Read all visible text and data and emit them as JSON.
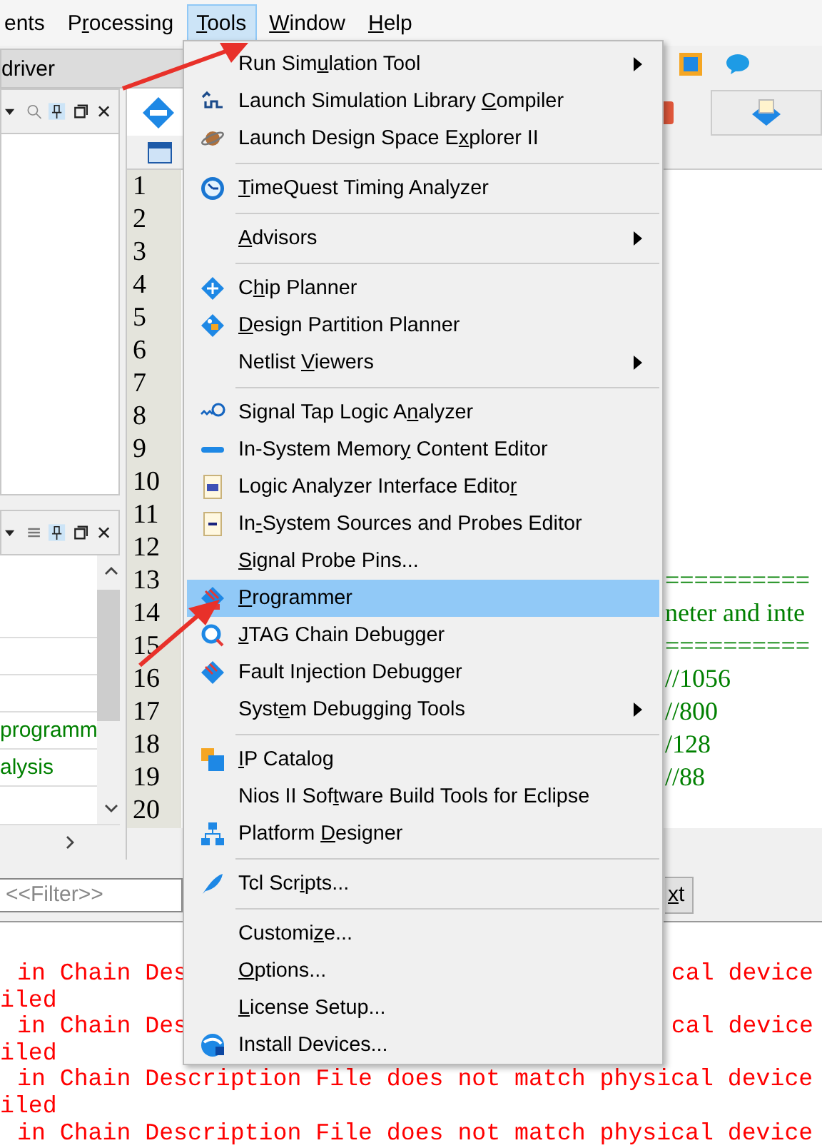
{
  "menu_bar": {
    "items": [
      {
        "label": [
          {
            "text": "ents"
          }
        ],
        "selected": false
      },
      {
        "label": [
          {
            "text": "P"
          },
          {
            "underlined": "r"
          },
          {
            "text": "ocessing"
          }
        ],
        "selected": false
      },
      {
        "label": [
          {
            "underlined": "T"
          },
          {
            "text": "ools"
          }
        ],
        "selected": true
      },
      {
        "label": [
          {
            "underlined": "W"
          },
          {
            "text": "indow"
          }
        ],
        "selected": false
      },
      {
        "label": [
          {
            "underlined": "H"
          },
          {
            "text": "elp"
          }
        ],
        "selected": false
      }
    ]
  },
  "left_panel": {
    "tab": "driver",
    "rows": [
      {
        "text": "programm",
        "color": "#008000"
      },
      {
        "text": "alysis",
        "color": "#008000"
      }
    ]
  },
  "editor": {
    "lines": [
      {
        "number": "1"
      },
      {
        "number": "2"
      },
      {
        "number": "3"
      },
      {
        "number": "4"
      },
      {
        "number": "5"
      },
      {
        "number": "6"
      },
      {
        "number": "7"
      },
      {
        "number": "8"
      },
      {
        "number": "9"
      },
      {
        "number": "10"
      },
      {
        "number": "11"
      },
      {
        "number": "12"
      },
      {
        "number": "13",
        "code": "=========="
      },
      {
        "number": "14",
        "code": "neter and inte"
      },
      {
        "number": "15",
        "code": "=========="
      },
      {
        "number": "16",
        "code": "//1056"
      },
      {
        "number": "17",
        "code": "//800"
      },
      {
        "number": "18",
        "code": "/128"
      },
      {
        "number": "19",
        "code": "//88"
      },
      {
        "number": "20"
      }
    ]
  },
  "filter": {
    "placeholder": "<<Filter>>",
    "button": [
      {
        "underlined": "x"
      },
      {
        "text": "t"
      }
    ]
  },
  "messages": [
    {
      "left": "in Chain Des",
      "right": "cal device"
    },
    {
      "left": "iled"
    },
    {
      "left": "in Chain Des",
      "right": "cal device"
    },
    {
      "left": "iled"
    },
    {
      "left": "in Chain Description File does not match physical device"
    },
    {
      "left": "iled"
    },
    {
      "left": "in Chain Description File does not match physical device"
    }
  ],
  "tools_menu": {
    "items": [
      {
        "kind": "item",
        "label": [
          {
            "text": "Run Sim"
          },
          {
            "underlined": "u"
          },
          {
            "text": "lation Tool"
          }
        ],
        "submenu": true,
        "selected": false
      },
      {
        "kind": "item",
        "label": [
          {
            "text": "Launch Simulation Library "
          },
          {
            "underlined": "C"
          },
          {
            "text": "ompiler"
          }
        ],
        "submenu": false,
        "selected": false
      },
      {
        "kind": "item",
        "label": [
          {
            "text": "Launch Design Space E"
          },
          {
            "underlined": "x"
          },
          {
            "text": "plorer II"
          }
        ],
        "submenu": false,
        "selected": false
      },
      {
        "kind": "separator"
      },
      {
        "kind": "item",
        "label": [
          {
            "underlined": "T"
          },
          {
            "text": "imeQuest Timing Analyzer"
          }
        ],
        "submenu": false,
        "selected": false
      },
      {
        "kind": "separator"
      },
      {
        "kind": "item",
        "label": [
          {
            "underlined": "A"
          },
          {
            "text": "dvisors"
          }
        ],
        "submenu": true,
        "selected": false
      },
      {
        "kind": "separator"
      },
      {
        "kind": "item",
        "label": [
          {
            "text": "C"
          },
          {
            "underlined": "h"
          },
          {
            "text": "ip Planner"
          }
        ],
        "submenu": false,
        "selected": false
      },
      {
        "kind": "item",
        "label": [
          {
            "underlined": "D"
          },
          {
            "text": "esign Partition Planner"
          }
        ],
        "submenu": false,
        "selected": false
      },
      {
        "kind": "item",
        "label": [
          {
            "text": "Netlist "
          },
          {
            "underlined": "V"
          },
          {
            "text": "iewers"
          }
        ],
        "submenu": true,
        "selected": false
      },
      {
        "kind": "separator"
      },
      {
        "kind": "item",
        "label": [
          {
            "text": "Signal Tap Logic A"
          },
          {
            "underlined": "n"
          },
          {
            "text": "alyzer"
          }
        ],
        "submenu": false,
        "selected": false
      },
      {
        "kind": "item",
        "label": [
          {
            "text": "In-System Memor"
          },
          {
            "underlined": "y"
          },
          {
            "text": " Content Editor"
          }
        ],
        "submenu": false,
        "selected": false
      },
      {
        "kind": "item",
        "label": [
          {
            "text": "Logic Analyzer Interface Edito"
          },
          {
            "underlined": "r"
          }
        ],
        "submenu": false,
        "selected": false
      },
      {
        "kind": "item",
        "label": [
          {
            "text": "In"
          },
          {
            "underlined": "-"
          },
          {
            "text": "System Sources and Probes Editor"
          }
        ],
        "submenu": false,
        "selected": false
      },
      {
        "kind": "item",
        "label": [
          {
            "underlined": "S"
          },
          {
            "text": "ignal Probe Pins..."
          }
        ],
        "submenu": false,
        "selected": false
      },
      {
        "kind": "item",
        "label": [
          {
            "underlined": "P"
          },
          {
            "text": "rogrammer"
          }
        ],
        "submenu": false,
        "selected": true
      },
      {
        "kind": "item",
        "label": [
          {
            "underlined": "J"
          },
          {
            "text": "TAG Chain Debugger"
          }
        ],
        "submenu": false,
        "selected": false
      },
      {
        "kind": "item",
        "label": [
          {
            "text": "Fault Injection Debugger"
          }
        ],
        "submenu": false,
        "selected": false
      },
      {
        "kind": "item",
        "label": [
          {
            "text": "Syst"
          },
          {
            "underlined": "e"
          },
          {
            "text": "m Debugging Tools"
          }
        ],
        "submenu": true,
        "selected": false
      },
      {
        "kind": "separator"
      },
      {
        "kind": "item",
        "label": [
          {
            "underlined": "I"
          },
          {
            "text": "P Catalog"
          }
        ],
        "submenu": false,
        "selected": false
      },
      {
        "kind": "item",
        "label": [
          {
            "text": "Nios II Sof"
          },
          {
            "underlined": "t"
          },
          {
            "text": "ware Build Tools for Eclipse"
          }
        ],
        "submenu": false,
        "selected": false
      },
      {
        "kind": "item",
        "label": [
          {
            "text": "Platform "
          },
          {
            "underlined": "D"
          },
          {
            "text": "esigner"
          }
        ],
        "submenu": false,
        "selected": false
      },
      {
        "kind": "separator"
      },
      {
        "kind": "item",
        "label": [
          {
            "text": "Tcl Scr"
          },
          {
            "underlined": "i"
          },
          {
            "text": "pts..."
          }
        ],
        "submenu": false,
        "selected": false
      },
      {
        "kind": "separator"
      },
      {
        "kind": "item",
        "label": [
          {
            "text": "Customi"
          },
          {
            "underlined": "z"
          },
          {
            "text": "e..."
          }
        ],
        "submenu": false,
        "selected": false
      },
      {
        "kind": "item",
        "label": [
          {
            "underlined": "O"
          },
          {
            "text": "ptions..."
          }
        ],
        "submenu": false,
        "selected": false
      },
      {
        "kind": "item",
        "label": [
          {
            "underlined": "L"
          },
          {
            "text": "icense Setup..."
          }
        ],
        "submenu": false,
        "selected": false
      },
      {
        "kind": "item",
        "label": [
          {
            "text": "Install Devices..."
          }
        ],
        "submenu": false,
        "selected": false
      }
    ]
  }
}
